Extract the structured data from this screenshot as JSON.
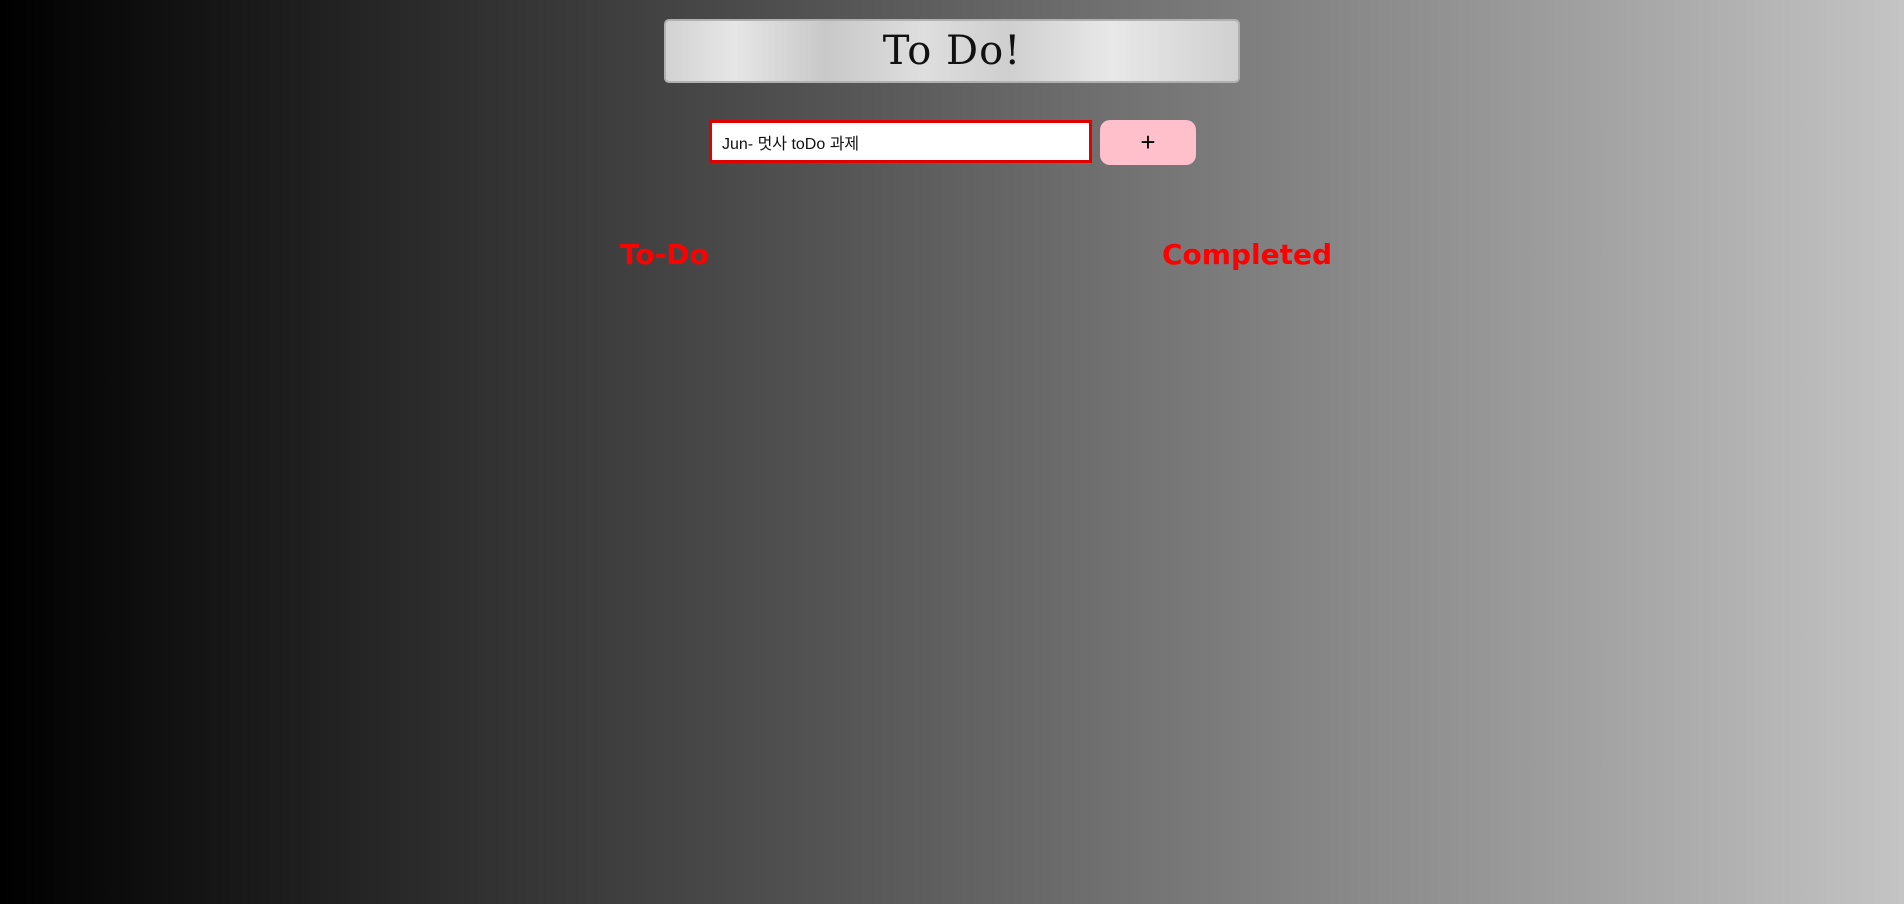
{
  "header": {
    "title": "To Do!"
  },
  "input": {
    "value": "Jun- 멋사 toDo 과제",
    "placeholder": ""
  },
  "add_button": {
    "label": "+"
  },
  "sections": {
    "todo_heading": "To-Do",
    "completed_heading": "Completed"
  },
  "colors": {
    "heading": "#ff0000",
    "input_border": "#e00000",
    "add_button_bg": "#ffc0cb"
  }
}
